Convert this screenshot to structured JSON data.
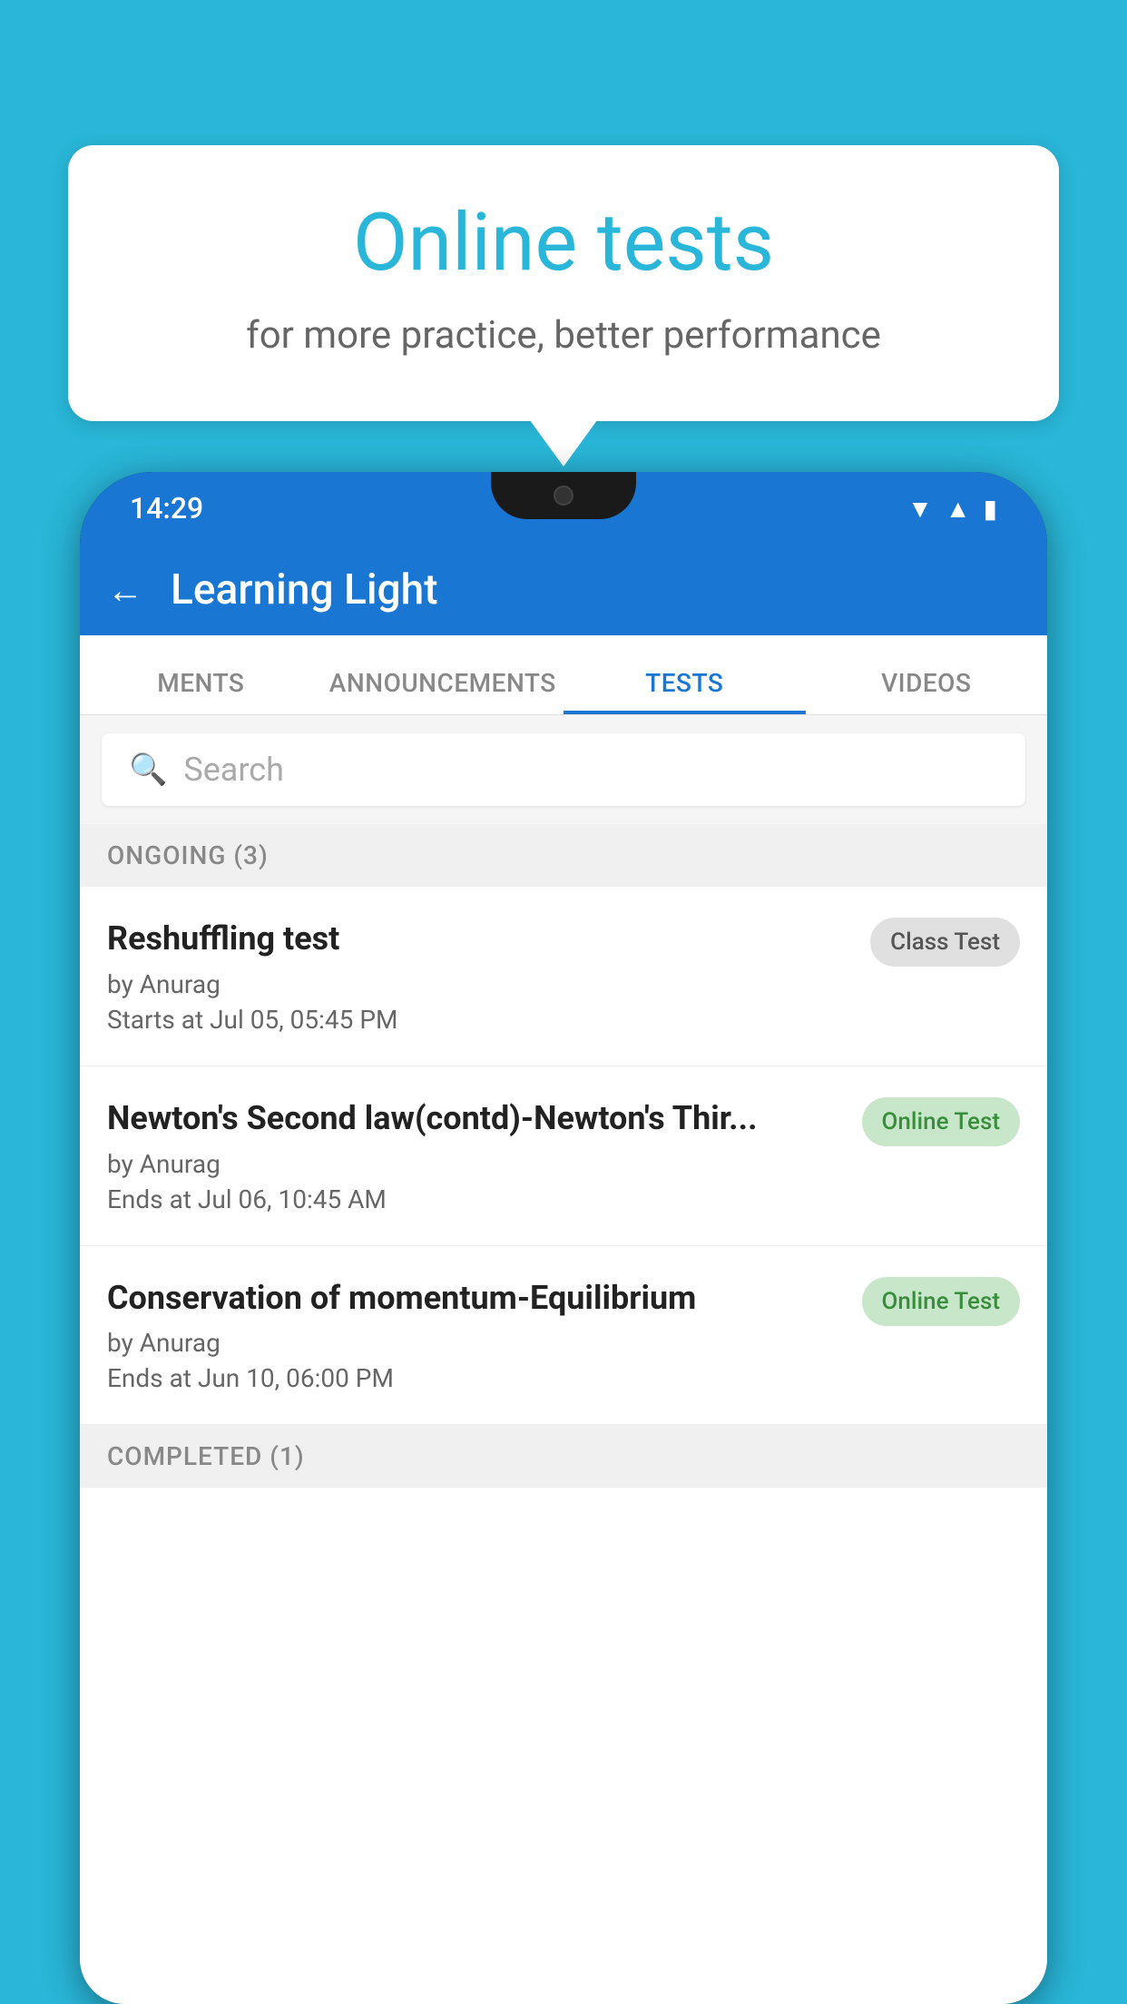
{
  "background": {
    "color": "#29b6d8"
  },
  "speech_bubble": {
    "title": "Online tests",
    "subtitle": "for more practice, better performance"
  },
  "phone": {
    "status_bar": {
      "time": "14:29",
      "icons": [
        "wifi",
        "signal",
        "battery"
      ]
    },
    "app_header": {
      "back_label": "←",
      "title": "Learning Light"
    },
    "tabs": [
      {
        "label": "MENTS",
        "active": false
      },
      {
        "label": "ANNOUNCEMENTS",
        "active": false
      },
      {
        "label": "TESTS",
        "active": true
      },
      {
        "label": "VIDEOS",
        "active": false
      }
    ],
    "search": {
      "placeholder": "Search",
      "icon": "🔍"
    },
    "ongoing_section": {
      "label": "ONGOING (3)",
      "tests": [
        {
          "name": "Reshuffling test",
          "author": "by Anurag",
          "date": "Starts at  Jul 05, 05:45 PM",
          "badge": "Class Test",
          "badge_type": "class"
        },
        {
          "name": "Newton's Second law(contd)-Newton's Thir...",
          "author": "by Anurag",
          "date": "Ends at  Jul 06, 10:45 AM",
          "badge": "Online Test",
          "badge_type": "online"
        },
        {
          "name": "Conservation of momentum-Equilibrium",
          "author": "by Anurag",
          "date": "Ends at  Jun 10, 06:00 PM",
          "badge": "Online Test",
          "badge_type": "online"
        }
      ]
    },
    "completed_section": {
      "label": "COMPLETED (1)"
    }
  }
}
